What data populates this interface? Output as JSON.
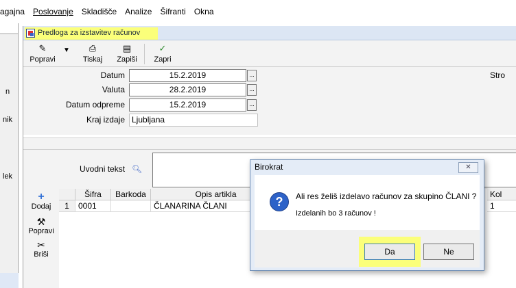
{
  "menu": {
    "items": [
      "agajna",
      "Poslovanje",
      "Skladišče",
      "Analize",
      "Šifranti",
      "Okna"
    ]
  },
  "left_fragments": [
    "n",
    "nik",
    "lek"
  ],
  "window": {
    "title": "Predloga za izstavitev računov"
  },
  "toolbar": {
    "popravi": "Popravi",
    "tiskaj": "Tiskaj",
    "zapisi": "Zapiši",
    "zapri": "Zapri"
  },
  "form": {
    "datum_label": "Datum",
    "datum_value": "15.2.2019",
    "valuta_label": "Valuta",
    "valuta_value": "28.2.2019",
    "odpreme_label": "Datum odpreme",
    "odpreme_value": "15.2.2019",
    "kraj_label": "Kraj izdaje",
    "kraj_value": "Ljubljana",
    "browse": "...",
    "stro_label": "Stro"
  },
  "intro": {
    "label": "Uvodni tekst",
    "value": ""
  },
  "side_buttons": {
    "dodaj": "Dodaj",
    "popravi": "Popravi",
    "brisi": "Briši"
  },
  "grid": {
    "columns": [
      "",
      "Šifra",
      "Barkoda",
      "Opis artikla",
      "Kol"
    ],
    "rows": [
      {
        "n": "1",
        "sifra": "0001",
        "barkoda": "",
        "opis": "ČLANARINA ČLANI",
        "kol": "1"
      }
    ]
  },
  "dialog": {
    "title": "Birokrat",
    "message": "Ali res želiš izdelavo računov za skupino ČLANI ?",
    "detail": "Izdelanih bo 3 računov !",
    "yes": "Da",
    "no": "Ne"
  },
  "colors": {
    "highlight": "#fbff7a",
    "title_bar": "#dce6f4",
    "dialog_bg": "#e4ecf7"
  }
}
